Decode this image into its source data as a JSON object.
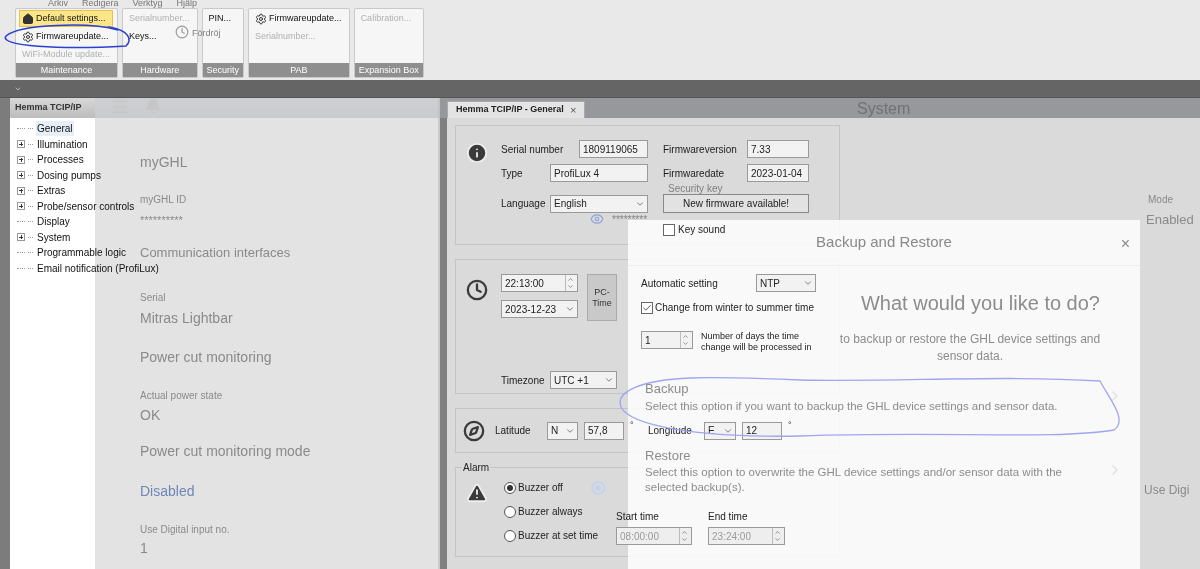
{
  "menu_bar": [
    "Arkiv",
    "Redigera",
    "Verktyg",
    "Hjälp"
  ],
  "quick_toolbar": [
    "Fördröj"
  ],
  "ribbon": [
    {
      "label": "Maintenance",
      "items": [
        {
          "label": "Default settings...",
          "highlighted": true,
          "disabled": false
        },
        {
          "label": "Firmwareupdate...",
          "highlighted": false,
          "disabled": false
        },
        {
          "label": "WiFi-Module update...",
          "highlighted": false,
          "disabled": true
        }
      ]
    },
    {
      "label": "Hardware",
      "items": [
        {
          "label": "Serialnumber...",
          "highlighted": false,
          "disabled": true
        },
        {
          "label": "Keys...",
          "highlighted": false,
          "disabled": false
        }
      ]
    },
    {
      "label": "Security",
      "items": [
        {
          "label": "PIN...",
          "highlighted": false,
          "disabled": false
        }
      ]
    },
    {
      "label": "PAB",
      "items": [
        {
          "label": "Firmwareupdate...",
          "highlighted": false,
          "disabled": false
        },
        {
          "label": "Serialnumber...",
          "highlighted": false,
          "disabled": true
        }
      ]
    },
    {
      "label": "Expansion Box",
      "items": [
        {
          "label": "Calibration...",
          "highlighted": false,
          "disabled": true
        }
      ]
    }
  ],
  "tree": {
    "header": "Hemma TCIP/IP",
    "items": [
      {
        "label": "General",
        "expandable": false,
        "selected": true
      },
      {
        "label": "Illumination",
        "expandable": true,
        "selected": false
      },
      {
        "label": "Processes",
        "expandable": true,
        "selected": false
      },
      {
        "label": "Dosing pumps",
        "expandable": true,
        "selected": false
      },
      {
        "label": "Extras",
        "expandable": true,
        "selected": false
      },
      {
        "label": "Probe/sensor controls",
        "expandable": true,
        "selected": false
      },
      {
        "label": "Display",
        "expandable": false,
        "selected": false
      },
      {
        "label": "System",
        "expandable": true,
        "selected": false
      },
      {
        "label": "Programmable logic",
        "expandable": false,
        "selected": false
      },
      {
        "label": "Email notification (ProfiLux)",
        "expandable": false,
        "selected": false
      }
    ]
  },
  "tab": {
    "label": "Hemma TCIP/IP - General",
    "close": "×"
  },
  "info": {
    "serial_label": "Serial number",
    "serial": "1809119065",
    "fw_version_label": "Firmwareversion",
    "fw_version": "7.33",
    "type_label": "Type",
    "type": "ProfiLux 4",
    "fw_date_label": "Firmwaredate",
    "fw_date": "2023-01-04",
    "language_label": "Language",
    "language": "English",
    "firmware_button": "New firmware available!",
    "key_sound": {
      "label": "Key sound",
      "checked": false
    }
  },
  "time": {
    "time": "22:13:00",
    "date": "2023-12-23",
    "pc_time_button": "PC-Time",
    "auto_label": "Automatic setting",
    "auto_value": "NTP",
    "dst": {
      "label": "Change from winter to summer time",
      "checked": true
    },
    "days": "1",
    "days_label": "Number of days the time change will be processed in",
    "timezone_label": "Timezone",
    "timezone": "UTC +1"
  },
  "location": {
    "latitude_label": "Latitude",
    "lat_dir": "N",
    "latitude": "57,8",
    "lat_unit": "°",
    "longitude_label": "Longitude",
    "lon_dir": "E",
    "longitude": "12",
    "lon_unit": "°"
  },
  "alarm": {
    "title": "Alarm",
    "options": [
      {
        "label": "Buzzer off",
        "selected": true
      },
      {
        "label": "Buzzer always",
        "selected": false
      },
      {
        "label": "Buzzer at set time",
        "selected": false
      }
    ],
    "start_label": "Start time",
    "start": "08:00:00",
    "end_label": "End time",
    "end": "23:24:00"
  },
  "background_app": {
    "title": "System",
    "items": [
      {
        "kind": "heading",
        "text": "myGHL"
      },
      {
        "kind": "caption",
        "text": "myGHL ID"
      },
      {
        "kind": "value",
        "text": "**********"
      },
      {
        "kind": "section",
        "text": "Communication interfaces"
      },
      {
        "kind": "caption",
        "text": "Serial"
      },
      {
        "kind": "heading",
        "text": "Mitras Lightbar"
      },
      {
        "kind": "heading",
        "text": "Power cut monitoring"
      },
      {
        "kind": "caption",
        "text": "Actual power state"
      },
      {
        "kind": "heading",
        "text": "OK"
      },
      {
        "kind": "heading",
        "text": "Power cut monitoring mode"
      },
      {
        "kind": "accent",
        "text": "Disabled"
      },
      {
        "kind": "caption",
        "text": "Use Digital input no."
      },
      {
        "kind": "heading",
        "text": "1"
      }
    ],
    "security_key_label": "Security key",
    "security_key": "*********",
    "mode_label": "Mode",
    "mode": "Enabled",
    "digital_input": "Use Digi"
  },
  "dialog": {
    "title": "Backup and Restore",
    "close": "×",
    "question": "What would you like to do?",
    "description": "to backup or restore the GHL device settings and sensor data.",
    "options": [
      {
        "title": "Backup",
        "description": "Select this option if you want to backup the GHL device settings and sensor data."
      },
      {
        "title": "Restore",
        "description": "Select this option to overwrite the GHL device settings and/or sensor data with the selected backup(s)."
      }
    ]
  }
}
